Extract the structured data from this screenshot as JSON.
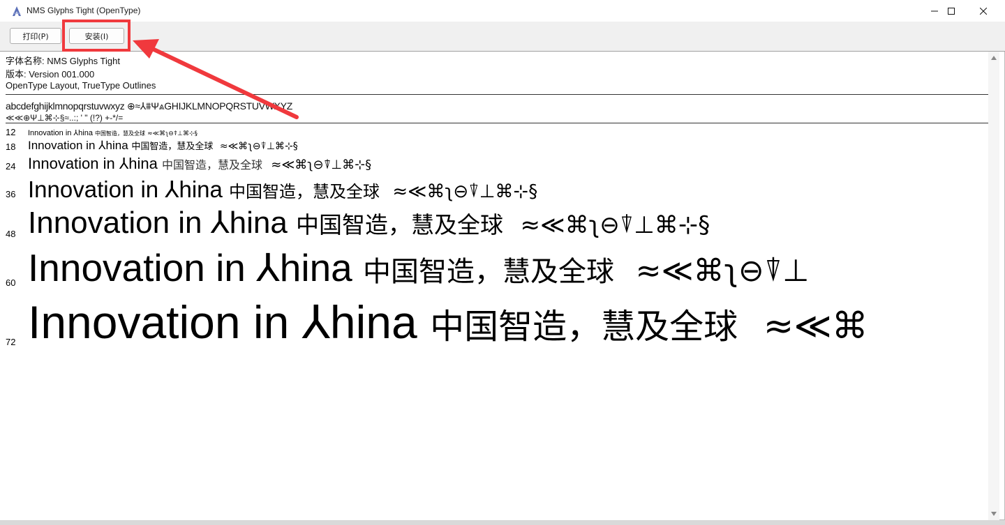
{
  "window": {
    "title": "NMS Glyphs Tight (OpenType)",
    "icon": "font-viewer-icon"
  },
  "toolbar": {
    "print_label": "打印(P)",
    "install_label": "安装(I)"
  },
  "info": {
    "font_name": "字体名称: NMS Glyphs Tight",
    "version": "版本: Version 001.000",
    "layout": "OpenType Layout, TrueType Outlines"
  },
  "charset": {
    "line1": "abcdefghijklmnopqrstuvwxyz ⊕≈⅄⩩Ψ⩓GHIJKLMNOPQRSTUVWXYZ",
    "line2": "≪≪⊕Ψ⊥⌘⊹§≈..:; ' \" (!?) +-*/="
  },
  "samples": [
    {
      "size": "12",
      "latin": "Innovation in ⅄hina",
      "cjk": "中国智造，慧及全球",
      "glyphs": "≈≪⌘ʅ⊖⍒⊥⌘⊹§"
    },
    {
      "size": "18",
      "latin": "Innovation in ⅄hina",
      "cjk": "中国智造，慧及全球",
      "glyphs": "≈≪⌘ʅ⊖⍒⊥⌘⊹§"
    },
    {
      "size": "24",
      "latin": "Innovation in ⅄hina",
      "cjk": "中国智造，慧及全球",
      "glyphs": "≈≪⌘ʅ⊖⍒⊥⌘⊹§"
    },
    {
      "size": "36",
      "latin": "Innovation in ⅄hina",
      "cjk": "中国智造，慧及全球",
      "glyphs": "≈≪⌘ʅ⊖⍒⊥⌘⊹§"
    },
    {
      "size": "48",
      "latin": "Innovation in ⅄hina",
      "cjk": "中国智造，慧及全球",
      "glyphs": "≈≪⌘ʅ⊖⍒⊥⌘⊹§"
    },
    {
      "size": "60",
      "latin": "Innovation in ⅄hina",
      "cjk": "中国智造，慧及全球",
      "glyphs": "≈≪⌘ʅ⊖⍒⊥"
    },
    {
      "size": "72",
      "latin": "Innovation in ⅄hina",
      "cjk": "中国智造，慧及全球",
      "glyphs": "≈≪⌘"
    }
  ],
  "colors": {
    "highlight": "#f0393d"
  }
}
